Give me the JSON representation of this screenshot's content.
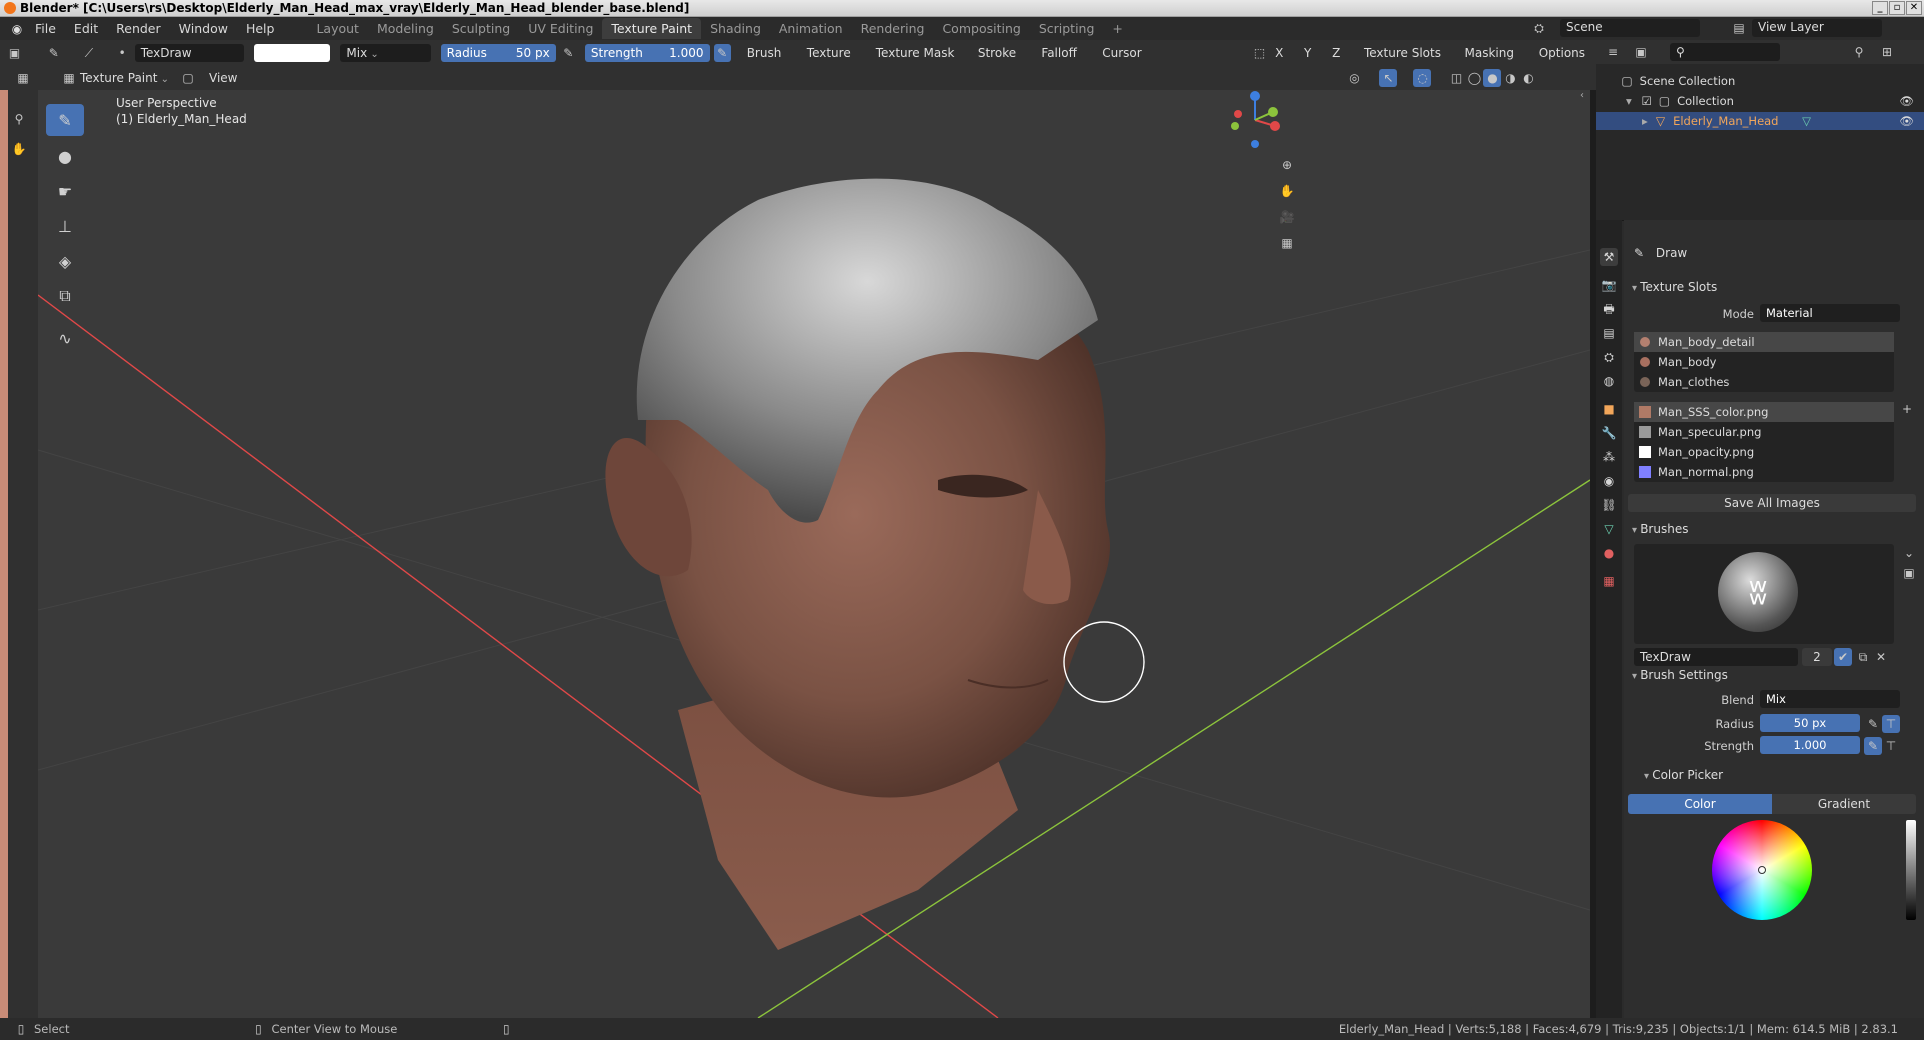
{
  "window": {
    "title": "Blender* [C:\\Users\\rs\\Desktop\\Elderly_Man_Head_max_vray\\Elderly_Man_Head_blender_base.blend]"
  },
  "menu": [
    "File",
    "Edit",
    "Render",
    "Window",
    "Help"
  ],
  "workspaces": [
    "Layout",
    "Modeling",
    "Sculpting",
    "UV Editing",
    "Texture Paint",
    "Shading",
    "Animation",
    "Rendering",
    "Compositing",
    "Scripting"
  ],
  "active_workspace": "Texture Paint",
  "scene": {
    "name": "Scene",
    "view_layer": "View Layer"
  },
  "tool_header": {
    "brush_name": "TexDraw",
    "blend": "Mix",
    "radius_label": "Radius",
    "radius_value": "50 px",
    "strength_label": "Strength",
    "strength_value": "1.000",
    "menus": [
      "Brush",
      "Texture",
      "Texture Mask",
      "Stroke",
      "Falloff",
      "Cursor"
    ],
    "axes": [
      "X",
      "Y",
      "Z"
    ],
    "right_menus": [
      "Texture Slots",
      "Masking",
      "Options"
    ]
  },
  "editor_header": {
    "mode": "Texture Paint",
    "view": "View"
  },
  "viewport": {
    "perspective": "User Perspective",
    "object": "(1) Elderly_Man_Head"
  },
  "outliner": {
    "root": "Scene Collection",
    "collection": "Collection",
    "object": "Elderly_Man_Head"
  },
  "properties": {
    "tool_name": "Draw",
    "texture_slots": {
      "title": "Texture Slots",
      "mode_label": "Mode",
      "mode_value": "Material",
      "materials": [
        {
          "name": "Man_body_detail",
          "color": "#b48070"
        },
        {
          "name": "Man_body",
          "color": "#a87060"
        },
        {
          "name": "Man_clothes",
          "color": "#7a6458"
        }
      ],
      "images": [
        {
          "name": "Man_SSS_color.png",
          "color": "#b07a66"
        },
        {
          "name": "Man_specular.png",
          "color": "#9a9a9a"
        },
        {
          "name": "Man_opacity.png",
          "color": "#ffffff"
        },
        {
          "name": "Man_normal.png",
          "color": "#8080ff"
        }
      ],
      "save_all": "Save All Images"
    },
    "brushes": {
      "title": "Brushes",
      "name": "TexDraw",
      "users": "2"
    },
    "brush_settings": {
      "title": "Brush Settings",
      "blend_label": "Blend",
      "blend_value": "Mix",
      "radius_label": "Radius",
      "radius_value": "50 px",
      "strength_label": "Strength",
      "strength_value": "1.000"
    },
    "color_picker": {
      "title": "Color Picker",
      "tab_color": "Color",
      "tab_gradient": "Gradient"
    }
  },
  "statusbar": {
    "select": "Select",
    "center": "Center View to Mouse",
    "stats": "Elderly_Man_Head | Verts:5,188 | Faces:4,679 | Tris:9,235 | Objects:1/1 | Mem: 614.5 MiB | 2.83.1"
  },
  "colors": {
    "accent": "#4772b3",
    "x_axis": "#e04848",
    "y_axis": "#8cc43c",
    "z_axis": "#3d7fe0"
  }
}
